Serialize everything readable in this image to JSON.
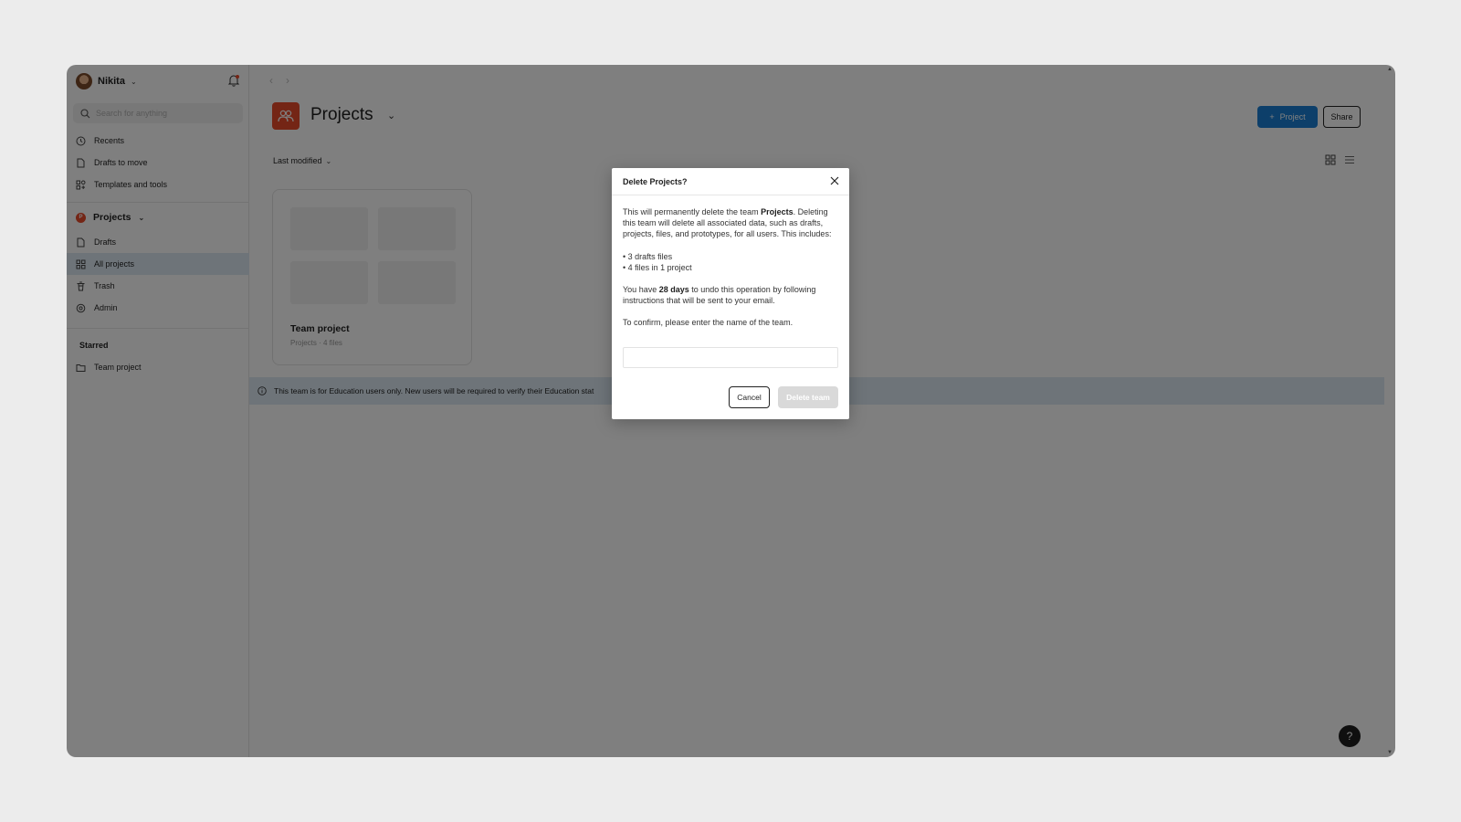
{
  "sidebar": {
    "user_name": "Nikita",
    "search_placeholder": "Search for anything",
    "top_items": [
      {
        "label": "Recents",
        "icon": "clock-icon"
      },
      {
        "label": "Drafts to move",
        "icon": "file-icon"
      },
      {
        "label": "Templates and tools",
        "icon": "templates-icon"
      }
    ],
    "team": {
      "initial": "P",
      "name": "Projects"
    },
    "team_items": [
      {
        "label": "Drafts",
        "icon": "file-icon"
      },
      {
        "label": "All projects",
        "icon": "grid-icon",
        "active": true
      },
      {
        "label": "Trash",
        "icon": "trash-icon"
      },
      {
        "label": "Admin",
        "icon": "gear-icon"
      }
    ],
    "starred_label": "Starred",
    "starred_items": [
      {
        "label": "Team project",
        "icon": "folder-icon"
      }
    ]
  },
  "header": {
    "title": "Projects",
    "project_button": "Project",
    "share_button": "Share"
  },
  "toolbar": {
    "sort_label": "Last modified"
  },
  "card": {
    "title": "Team project",
    "subtitle": "Projects · 4 files"
  },
  "banner": {
    "text": "This team is for Education users only. New users will be required to verify their Education stat"
  },
  "help_label": "?",
  "dialog": {
    "title": "Delete Projects?",
    "para1_prefix": "This will permanently delete the team ",
    "para1_bold": "Projects",
    "para1_suffix": ". Deleting this team will delete all associated data, such as drafts, projects, files, and prototypes, for all users. This includes:",
    "bullet1": "• 3 drafts files",
    "bullet2": "• 4 files in 1 project",
    "para2_prefix": "You have ",
    "para2_bold": "28 days",
    "para2_suffix": " to undo this operation by following instructions that will be sent to your email.",
    "confirm_text": "To confirm, please enter the name of the team.",
    "input_value": "",
    "cancel_label": "Cancel",
    "delete_label": "Delete team"
  },
  "colors": {
    "accent": "#1a7fd4",
    "team": "#e84a2a",
    "active_bg": "#dce9f3"
  }
}
